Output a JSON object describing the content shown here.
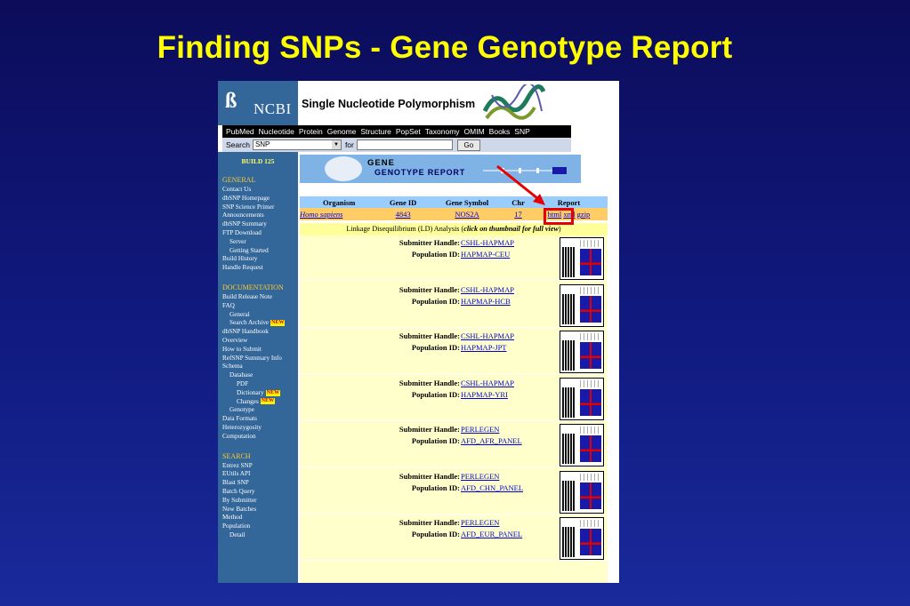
{
  "slide": {
    "title": "Finding SNPs - Gene Genotype Report"
  },
  "header": {
    "logo_text": "NCBI",
    "title": "Single Nucleotide Polymorphism"
  },
  "nav": [
    "PubMed",
    "Nucleotide",
    "Protein",
    "Genome",
    "Structure",
    "PopSet",
    "Taxonomy",
    "OMIM",
    "Books",
    "SNP"
  ],
  "search": {
    "label": "Search",
    "db": "SNP",
    "for": "for",
    "button": "Go"
  },
  "sidebar": {
    "build": "BUILD 125",
    "general_title": "GENERAL",
    "general": [
      "Contact Us",
      "dbSNP Homepage",
      "SNP Science Primer",
      "Announcements",
      "dbSNP Summary",
      "FTP Download",
      "Server",
      "Getting Started",
      "Build History",
      "Handle Request"
    ],
    "documentation_title": "DOCUMENTATION",
    "documentation": [
      "Build Release Note",
      "FAQ",
      "General",
      "Search Archive",
      "dbSNP Handbook",
      "Overview",
      "How to Submit",
      "RefSNP Summary Info",
      "Schema",
      "Database",
      "PDF",
      "Dictionary",
      "Changes",
      "Genotype",
      "Data Formats",
      "Heterozygosity",
      "Computation"
    ],
    "search_title": "SEARCH",
    "search_items": [
      "Entrez SNP",
      "EUtils API",
      "Blast SNP",
      "Batch Query",
      "By Submitter",
      "New Batches",
      "Method",
      "Population",
      "Detail"
    ],
    "new_badge": "NEW"
  },
  "banner": {
    "line1": "GENE",
    "line2": "GENOTYPE REPORT"
  },
  "table": {
    "headers": [
      "Organism",
      "Gene ID",
      "Gene Symbol",
      "Chr",
      "Report"
    ],
    "row": {
      "organism": "Homo sapiens",
      "gene_id": "4843",
      "gene_symbol": "NOS2A",
      "chr": "17",
      "report_html": "html",
      "report_xml": "xml",
      "report_gzip": "gzip"
    }
  },
  "ld": {
    "title_prefix": "Linkage Disequilibrium (LD) Analysis (",
    "title_emph": "click on thumbnail for full view",
    "title_suffix": ")",
    "submitter_label": "Submitter Handle:",
    "population_label": "Population ID:",
    "entries": [
      {
        "submitter": "CSHL-HAPMAP",
        "population": "HAPMAP-CEU"
      },
      {
        "submitter": "CSHL-HAPMAP",
        "population": "HAPMAP-HCB"
      },
      {
        "submitter": "CSHL-HAPMAP",
        "population": "HAPMAP-JPT"
      },
      {
        "submitter": "CSHL-HAPMAP",
        "population": "HAPMAP-YRI"
      },
      {
        "submitter": "PERLEGEN",
        "population": "AFD_AFR_PANEL"
      },
      {
        "submitter": "PERLEGEN",
        "population": "AFD_CHN_PANEL"
      },
      {
        "submitter": "PERLEGEN",
        "population": "AFD_EUR_PANEL"
      }
    ]
  },
  "colors": {
    "slide_bg": "#101a80",
    "title": "#ffff00",
    "sidebar": "#336699",
    "highlight": "#e60000"
  }
}
